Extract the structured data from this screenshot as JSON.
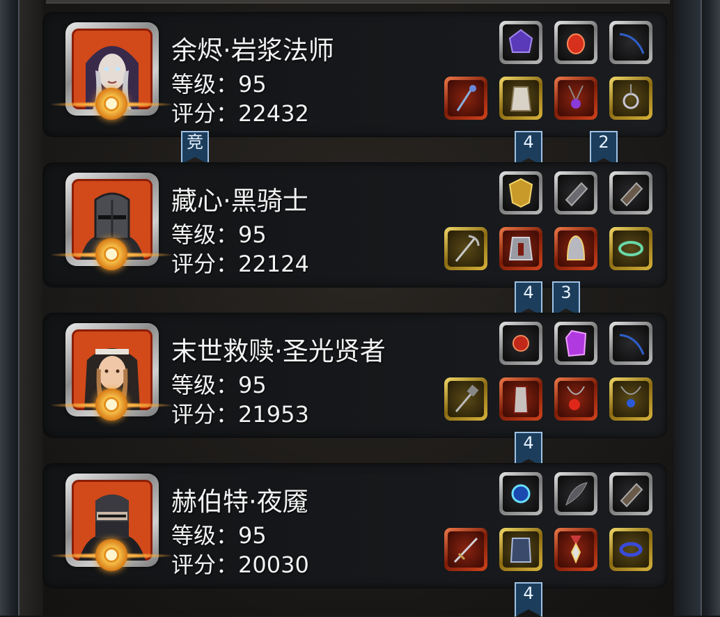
{
  "heroes": [
    {
      "name": "余烬·岩浆法师",
      "level": "等级：95",
      "score": "评分：22432",
      "portrait": "hooded-mage-portrait",
      "slots_top": [
        {
          "icon": "purple-gem-icon",
          "rarity": "silver"
        },
        {
          "icon": "red-heart-gem-icon",
          "rarity": "silver"
        },
        {
          "icon": "blue-bow-icon",
          "rarity": "silver"
        }
      ],
      "slots_bottom": [
        {
          "icon": "staff-icon",
          "rarity": "red"
        },
        {
          "icon": "robe-armor-icon",
          "rarity": "gold"
        },
        {
          "icon": "amulet-icon",
          "rarity": "red"
        },
        {
          "icon": "pentagram-amulet-icon",
          "rarity": "gold"
        }
      ]
    },
    {
      "name": "藏心·黑骑士",
      "level": "等级：95",
      "score": "评分：22124",
      "portrait": "helmet-knight-portrait",
      "slots_top": [
        {
          "icon": "golden-shield-icon",
          "rarity": "silver"
        },
        {
          "icon": "gauntlet-icon",
          "rarity": "silver"
        },
        {
          "icon": "gauntlet-icon",
          "rarity": "silver"
        }
      ],
      "slots_bottom": [
        {
          "icon": "pickaxe-icon",
          "rarity": "gold"
        },
        {
          "icon": "plate-armor-icon",
          "rarity": "red"
        },
        {
          "icon": "helmet-icon",
          "rarity": "red"
        },
        {
          "icon": "bracelet-icon",
          "rarity": "gold"
        }
      ]
    },
    {
      "name": "末世救赎·圣光贤者",
      "level": "等级：95",
      "score": "评分：21953",
      "portrait": "nun-sage-portrait",
      "slots_top": [
        {
          "icon": "red-orb-relic-icon",
          "rarity": "silver"
        },
        {
          "icon": "purple-crystal-icon",
          "rarity": "silver"
        },
        {
          "icon": "blue-bow-icon",
          "rarity": "silver"
        }
      ],
      "slots_bottom": [
        {
          "icon": "mace-icon",
          "rarity": "gold"
        },
        {
          "icon": "red-robe-icon",
          "rarity": "red"
        },
        {
          "icon": "red-amulet-icon",
          "rarity": "red"
        },
        {
          "icon": "blue-amulet-icon",
          "rarity": "gold"
        }
      ]
    },
    {
      "name": "赫伯特·夜魇",
      "level": "等级：95",
      "score": "评分：20030",
      "portrait": "masked-ninja-portrait",
      "slots_top": [
        {
          "icon": "blue-swirl-orb-icon",
          "rarity": "silver"
        },
        {
          "icon": "feather-blade-icon",
          "rarity": "silver"
        },
        {
          "icon": "gauntlet-icon",
          "rarity": "silver"
        }
      ],
      "slots_bottom": [
        {
          "icon": "sword-icon",
          "rarity": "red"
        },
        {
          "icon": "blue-armor-icon",
          "rarity": "gold"
        },
        {
          "icon": "medal-icon",
          "rarity": "red"
        },
        {
          "icon": "blue-ring-icon",
          "rarity": "gold"
        }
      ]
    }
  ],
  "tags": {
    "compete": "竞",
    "row1_a": "4",
    "row1_b": "2",
    "row2_a": "4",
    "row2_b": "3",
    "row3_a": "4",
    "row4_a": "4"
  },
  "colors": {
    "tag_bg": "#1c3e5c",
    "portrait_bg": "#d2491a",
    "card_bg": "#15171a"
  }
}
